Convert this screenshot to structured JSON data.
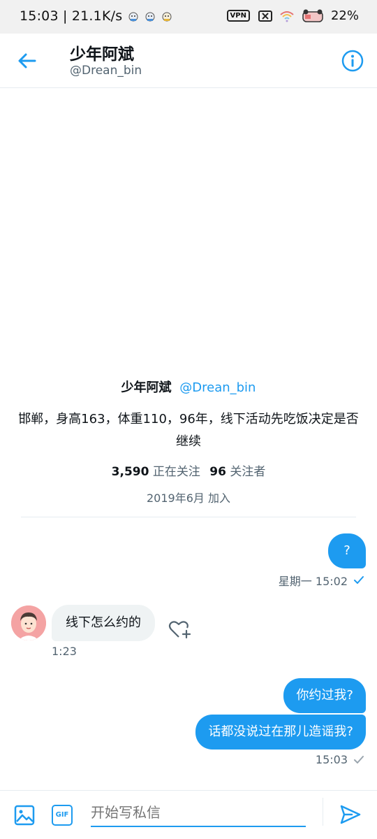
{
  "status_bar": {
    "time_speed": "15:03 | 21.1K/s",
    "vpn": "VPN",
    "battery": "22%"
  },
  "header": {
    "name": "少年阿斌",
    "handle": "@Drean_bin",
    "back_icon": "arrow-left-icon",
    "info_icon": "info-circle-icon"
  },
  "profile": {
    "name": "少年阿斌",
    "handle": "@Drean_bin",
    "bio": "邯郸，身高163，体重110，96年，线下活动先吃饭决定是否继续",
    "following_count": "3,590",
    "following_label": "正在关注",
    "followers_count": "96",
    "followers_label": "关注者",
    "joined": "2019年6月 加入"
  },
  "messages": [
    {
      "direction": "out",
      "text": "?",
      "time": "星期一 15:02",
      "read": true
    },
    {
      "direction": "in",
      "text": "线下怎么约的",
      "time": "1:23"
    },
    {
      "direction": "out",
      "text": "你约过我?"
    },
    {
      "direction": "out",
      "text": "话都没说过在那儿造谣我?",
      "time": "15:03",
      "read": false
    }
  ],
  "composer": {
    "placeholder": "开始写私信",
    "gif_label": "GIF",
    "image_icon": "image-icon",
    "send_icon": "send-icon"
  },
  "colors": {
    "accent": "#1d9bf0",
    "incoming_bubble": "#eff3f4",
    "secondary_text": "#536471"
  }
}
